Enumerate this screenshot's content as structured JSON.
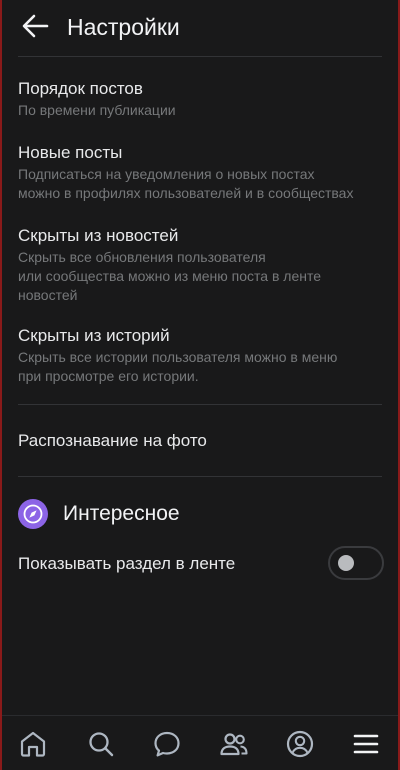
{
  "header": {
    "title": "Настройки",
    "back_icon": "arrow-left-icon"
  },
  "settings": [
    {
      "title": "Порядок постов",
      "description": "По времени публикации"
    },
    {
      "title": "Новые посты",
      "description": "Подписаться на уведомления о новых постах\nможно в профилях пользователей и в сообществах"
    },
    {
      "title": "Скрыты из новостей",
      "description": "Скрыть все обновления пользователя\nили сообщества можно из меню поста в ленте\nновостей"
    },
    {
      "title": "Скрыты из историй",
      "description": "Скрыть все истории пользователя можно в меню\nпри просмотре его истории."
    },
    {
      "title": "Распознавание на фото",
      "description": ""
    }
  ],
  "interesting": {
    "title": "Интересное",
    "icon": "compass-icon",
    "icon_color": "#8c64e6",
    "toggle_label": "Показывать раздел в ленте",
    "toggle_on": false
  },
  "tabbar": {
    "tabs": [
      "home-icon",
      "search-icon",
      "messages-icon",
      "friends-icon",
      "profile-icon",
      "menu-icon"
    ]
  },
  "colors": {
    "background": "#19191a",
    "text": "#e1e3e6",
    "secondary_text": "#76787a",
    "frame": "#8a1a1a"
  }
}
